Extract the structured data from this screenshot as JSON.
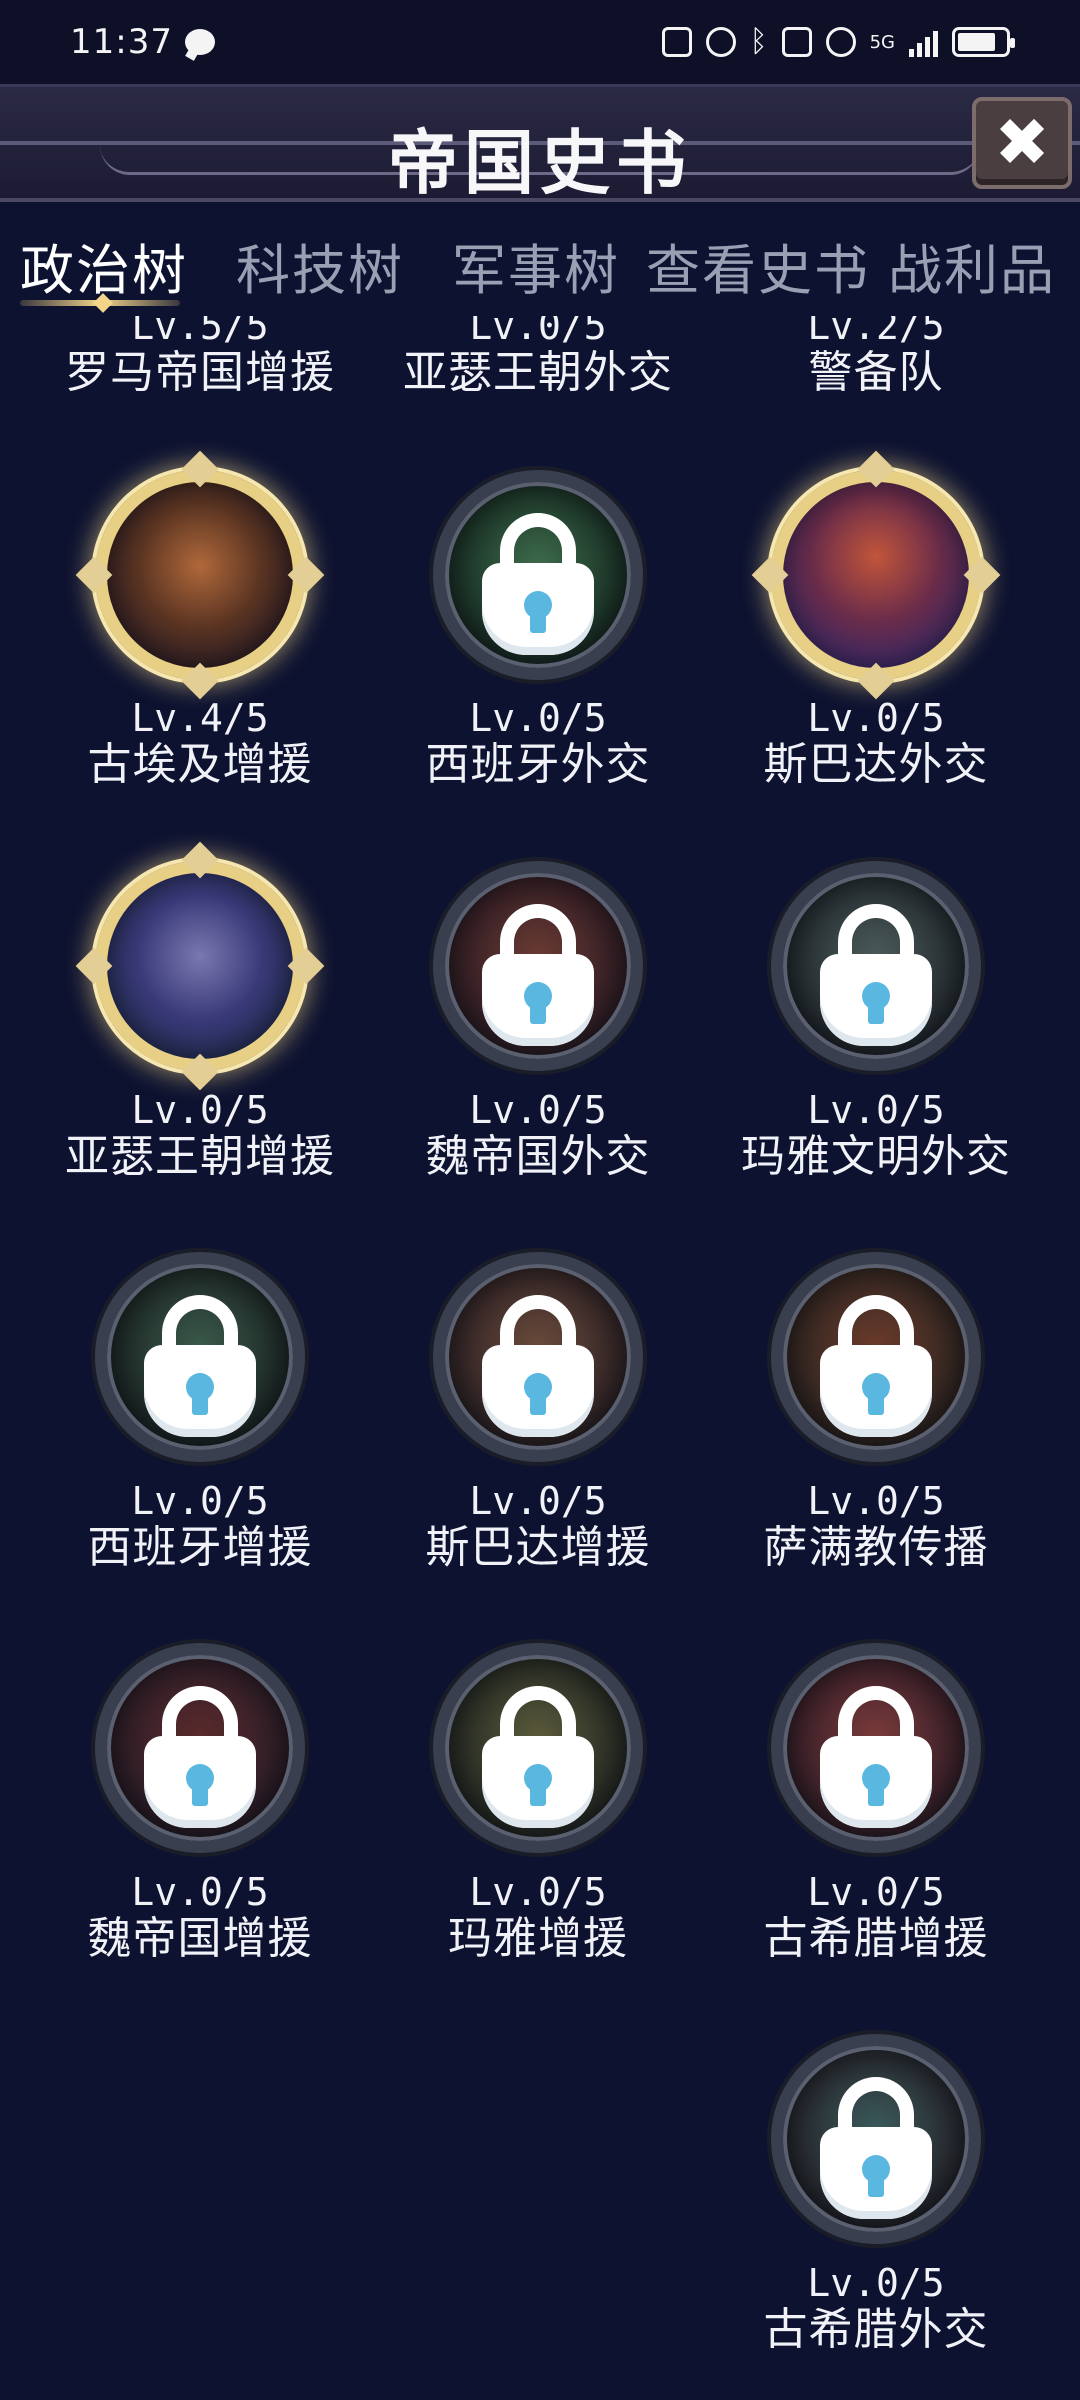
{
  "status_bar": {
    "time": "11:37",
    "network_label": "5G"
  },
  "header": {
    "title": "帝国史书",
    "close_label": "✖"
  },
  "tabs": [
    {
      "label": "政治树",
      "active": true
    },
    {
      "label": "科技树",
      "active": false
    },
    {
      "label": "军事树",
      "active": false
    },
    {
      "label": "查看史书",
      "active": false
    },
    {
      "label": "战利品",
      "active": false
    }
  ],
  "nodes": [
    {
      "level": "Lv.5/5",
      "name": "罗马帝国增援",
      "state": "partial"
    },
    {
      "level": "Lv.0/5",
      "name": "亚瑟王朝外交",
      "state": "partial"
    },
    {
      "level": "Lv.2/5",
      "name": "警备队",
      "state": "partial"
    },
    {
      "level": "Lv.4/5",
      "name": "古埃及增援",
      "state": "unlocked",
      "art": "egypt-temple"
    },
    {
      "level": "Lv.0/5",
      "name": "西班牙外交",
      "state": "locked",
      "art": "forest"
    },
    {
      "level": "Lv.0/5",
      "name": "斯巴达外交",
      "state": "unlocked",
      "art": "spartan-warrior"
    },
    {
      "level": "Lv.0/5",
      "name": "亚瑟王朝增援",
      "state": "unlocked",
      "art": "knight-statue"
    },
    {
      "level": "Lv.0/5",
      "name": "魏帝国外交",
      "state": "locked",
      "art": "pagoda"
    },
    {
      "level": "Lv.0/5",
      "name": "玛雅文明外交",
      "state": "locked",
      "art": "maya-stairs"
    },
    {
      "level": "Lv.0/5",
      "name": "西班牙增援",
      "state": "locked",
      "art": "cathedral"
    },
    {
      "level": "Lv.0/5",
      "name": "斯巴达增援",
      "state": "locked",
      "art": "columns"
    },
    {
      "level": "Lv.0/5",
      "name": "萨满教传播",
      "state": "locked",
      "art": "totem"
    },
    {
      "level": "Lv.0/5",
      "name": "魏帝国增援",
      "state": "locked",
      "art": "palace"
    },
    {
      "level": "Lv.0/5",
      "name": "玛雅增援",
      "state": "locked",
      "art": "pyramid"
    },
    {
      "level": "Lv.0/5",
      "name": "古希腊增援",
      "state": "locked",
      "art": "greek-hall"
    },
    {
      "level": "Lv.0/5",
      "name": "古希腊外交",
      "state": "locked",
      "art": "greek-warrior"
    }
  ],
  "colors": {
    "background": "#0d1230",
    "gold_frame": "#e7cf85",
    "lock_keyhole": "#5ab8e0",
    "tab_inactive": "#9aa0b4"
  }
}
